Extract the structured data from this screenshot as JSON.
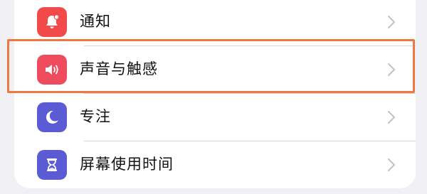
{
  "settings": {
    "items": [
      {
        "label": "通知",
        "icon": "bell-badge-icon",
        "color": "#f24a4a"
      },
      {
        "label": "声音与触感",
        "icon": "speaker-wave-icon",
        "color": "#ef4b5e"
      },
      {
        "label": "专注",
        "icon": "crescent-moon-icon",
        "color": "#5b5bd6"
      },
      {
        "label": "屏幕使用时间",
        "icon": "hourglass-icon",
        "color": "#5b5bd6"
      }
    ]
  },
  "highlight_color": "#f07840"
}
